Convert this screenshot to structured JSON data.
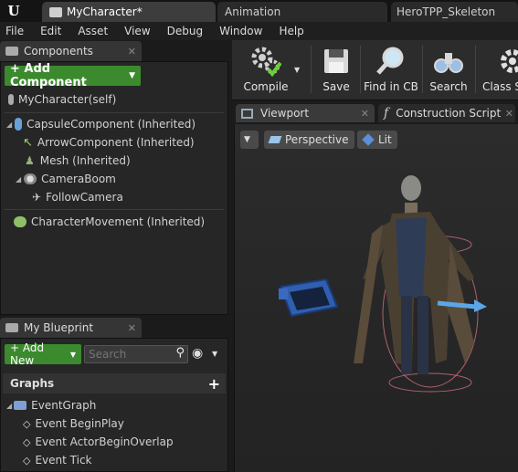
{
  "tabs": {
    "tab1": "MyCharacter*",
    "tab2": "Animation",
    "tab3": "HeroTPP_Skeleton"
  },
  "menu": [
    "File",
    "Edit",
    "Asset",
    "View",
    "Debug",
    "Window",
    "Help"
  ],
  "components_panel": {
    "title": "Components",
    "add_label": "+ Add Component",
    "self": "MyCharacter(self)",
    "items": [
      "CapsuleComponent (Inherited)",
      "ArrowComponent (Inherited)",
      "Mesh (Inherited)",
      "CameraBoom",
      "FollowCamera",
      "CharacterMovement (Inherited)"
    ]
  },
  "blueprint_panel": {
    "title": "My Blueprint",
    "add_new": "+ Add New",
    "search_placeholder": "Search",
    "graphs_header": "Graphs",
    "event_graph": "EventGraph",
    "events": [
      "Event BeginPlay",
      "Event ActorBeginOverlap",
      "Event Tick"
    ]
  },
  "toolbar": {
    "compile": "Compile",
    "save": "Save",
    "find": "Find in CB",
    "search": "Search",
    "class": "Class S"
  },
  "editor_tabs": {
    "viewport": "Viewport",
    "construction": "Construction Script"
  },
  "viewport": {
    "perspective": "Perspective",
    "lit": "Lit"
  },
  "colors": {
    "green_button": "#3c8a2e",
    "panel_bg": "#262626",
    "viewport_bg": "#2a2a2a"
  }
}
